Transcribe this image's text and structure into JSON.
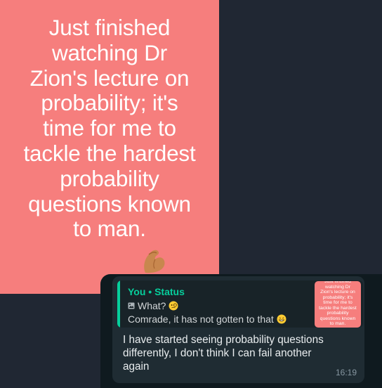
{
  "status": {
    "text": "Just finished\nwatching Dr\nZion's lecture on\nprobability; it's\ntime for me to\ntackle the hardest\nprobability\nquestions known\nto man.",
    "emoji": "flexed-biceps-icon"
  },
  "reply": {
    "quoted_header": "You • Status",
    "quoted_line": "What?",
    "quoted_emoji": "face-with-monocle-icon",
    "quoted_reply": "Comrade, it has not gotten to that",
    "quoted_reply_emoji": "grinning-face-icon",
    "thumbnail_text": "Just finished\nwatching Dr\nZion's lecture on\nprobability; it's\ntime for me to\ntackle the hardest\nprobability\nquestions known\nto man.",
    "message": "I have started seeing probability questions\ndifferently, I don't think I can fail another\nagain",
    "time": "16:19"
  },
  "colors": {
    "status_bg": "#f67e7d",
    "chat_bg": "#202733",
    "bubble": "#1f2c33",
    "accent": "#06cf9c"
  }
}
